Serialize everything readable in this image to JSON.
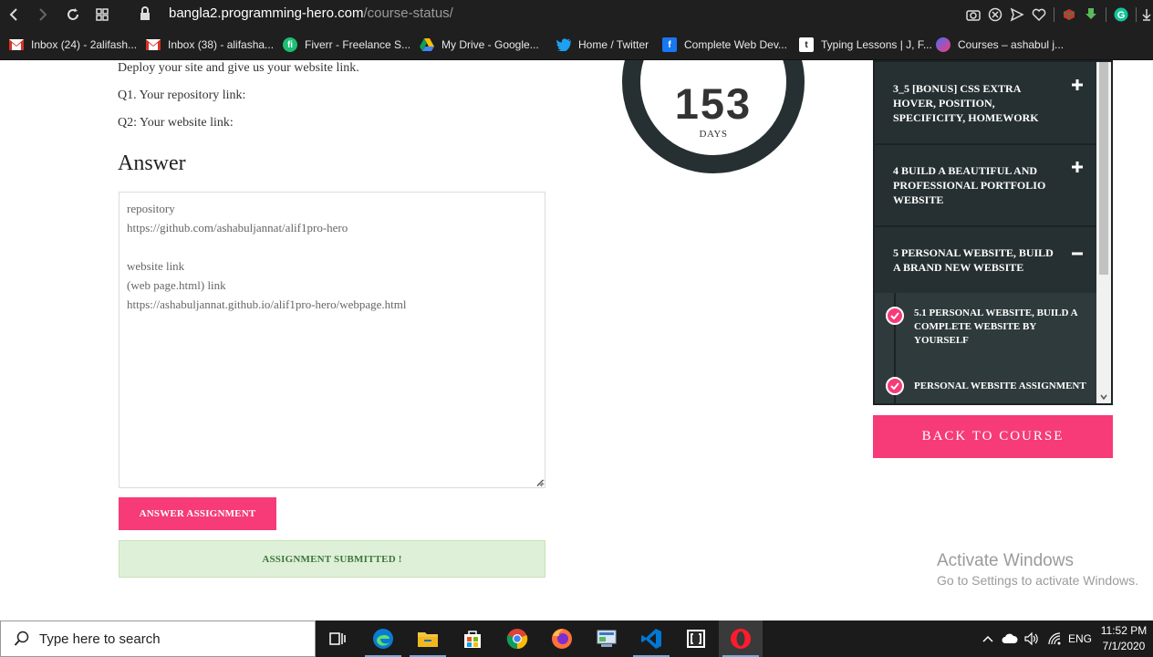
{
  "browser": {
    "url_host": "bangla2.programming-hero.com",
    "url_path": "/course-status/",
    "bookmarks": [
      {
        "label": "Inbox (24) - 2alifash...",
        "icon": "gmail-icon"
      },
      {
        "label": "Inbox (38) - alifasha...",
        "icon": "gmail-icon"
      },
      {
        "label": "Fiverr - Freelance S...",
        "icon": "fiverr-icon"
      },
      {
        "label": "My Drive - Google...",
        "icon": "google-drive-icon"
      },
      {
        "label": "Home / Twitter",
        "icon": "twitter-icon"
      },
      {
        "label": "Complete Web Dev...",
        "icon": "facebook-icon"
      },
      {
        "label": "Typing Lessons | J, F...",
        "icon": "typing-icon"
      },
      {
        "label": "Courses – ashabul j...",
        "icon": "course-icon"
      }
    ]
  },
  "assignment": {
    "instruction": "Deploy your site and give us your website link.",
    "q1": "Q1. Your repository link:",
    "q2": "Q2: Your website link:",
    "answer_heading": "Answer",
    "answer_text": "repository\nhttps://github.com/ashabuljannat/alif1pro-hero\n\nwebsite link\n(web page.html) link\nhttps://ashabuljannat.github.io/alif1pro-hero/webpage.html",
    "answer_button": "ANSWER ASSIGNMENT",
    "submitted_message": "ASSIGNMENT SUBMITTED !"
  },
  "countdown": {
    "value": "153",
    "unit": "DAYS"
  },
  "sidebar": {
    "modules": [
      {
        "title": "3_5 [BONUS] CSS EXTRA HOVER, POSITION, SPECIFICITY, HOMEWORK",
        "state": "collapsed"
      },
      {
        "title": "4 BUILD A BEAUTIFUL AND PROFESSIONAL PORTFOLIO WEBSITE",
        "state": "collapsed"
      },
      {
        "title": "5 PERSONAL WEBSITE, BUILD A BRAND NEW WEBSITE",
        "state": "expanded"
      }
    ],
    "lessons": [
      {
        "title": "5.1 PERSONAL WEBSITE, BUILD A COMPLETE WEBSITE BY YOURSELF",
        "completed": true
      },
      {
        "title": "PERSONAL WEBSITE ASSIGNMENT",
        "completed": true
      }
    ],
    "back_button": "BACK TO COURSE"
  },
  "watermark": {
    "title": "Activate Windows",
    "subtitle": "Go to Settings to activate Windows."
  },
  "taskbar": {
    "search_placeholder": "Type here to search",
    "language": "ENG",
    "time": "11:52 PM",
    "date": "7/1/2020"
  },
  "colors": {
    "accent": "#f63b78",
    "sidebar_bg": "#263032",
    "success_bg": "#dff0d8",
    "success_text": "#3c763d"
  }
}
